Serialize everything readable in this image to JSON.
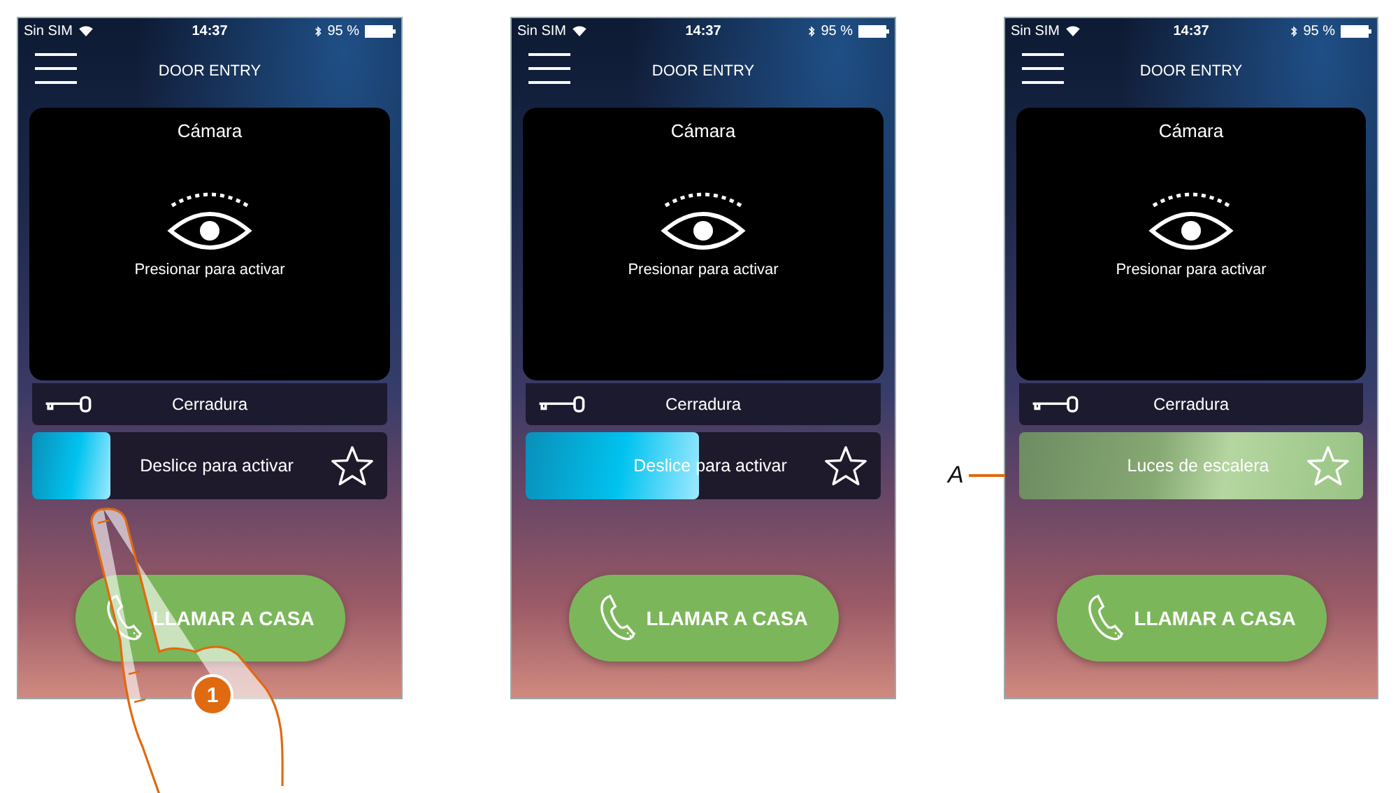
{
  "phones": [
    {
      "status_bar": {
        "carrier": "Sin SIM",
        "time": "14:37",
        "battery": "95 %"
      },
      "header": {
        "title": "DOOR ENTRY"
      },
      "camera": {
        "title": "Cámara",
        "hint": "Presionar para activar"
      },
      "lock": {
        "label": "Cerradura"
      },
      "slider": {
        "label": "Deslice para activar",
        "activated": false,
        "level": 0.22
      },
      "call_button": {
        "label": "LLAMAR A CASA"
      },
      "annotation": {
        "kind": "hand",
        "label": "1"
      }
    },
    {
      "status_bar": {
        "carrier": "Sin SIM",
        "time": "14:37",
        "battery": "95 %"
      },
      "header": {
        "title": "DOOR ENTRY"
      },
      "camera": {
        "title": "Cámara",
        "hint": "Presionar para activar"
      },
      "lock": {
        "label": "Cerradura"
      },
      "slider": {
        "label": "Deslice para activar",
        "activated": false,
        "level": 0.49
      },
      "call_button": {
        "label": "LLAMAR A CASA"
      }
    },
    {
      "status_bar": {
        "carrier": "Sin SIM",
        "time": "14:37",
        "battery": "95 %"
      },
      "header": {
        "title": "DOOR ENTRY"
      },
      "camera": {
        "title": "Cámara",
        "hint": "Presionar para activar"
      },
      "lock": {
        "label": "Cerradura"
      },
      "slider": {
        "label": "Luces de escalera",
        "activated": true
      },
      "call_button": {
        "label": "LLAMAR A CASA"
      },
      "annotation": {
        "kind": "leader",
        "label": "A"
      }
    }
  ]
}
